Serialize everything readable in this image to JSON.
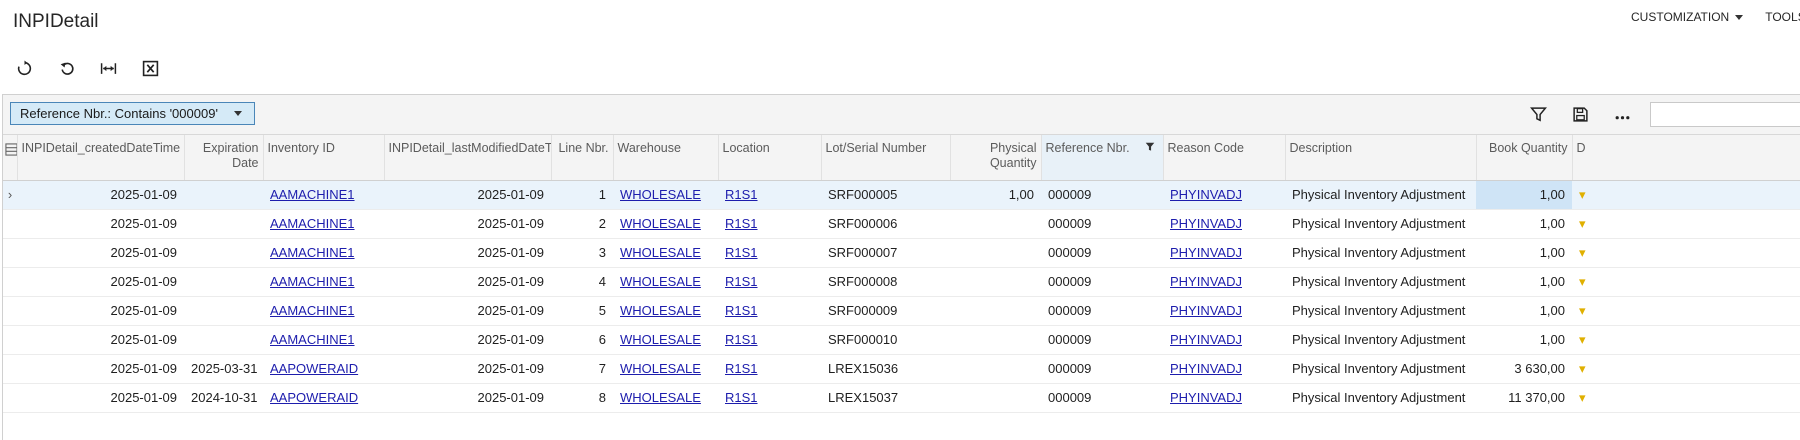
{
  "page": {
    "title": "INPIDetail",
    "menus": [
      "CUSTOMIZATION",
      "TOOLS"
    ]
  },
  "toolbar": {
    "buttons": [
      "refresh-icon",
      "undo-icon",
      "fit-to-screen-icon",
      "export-excel-icon"
    ]
  },
  "filter": {
    "chip_label": "Reference Nbr.: Contains '000009'",
    "search_placeholder": "",
    "icons": [
      "funnel-icon",
      "save-icon",
      "more-icon"
    ]
  },
  "colors": {
    "link": "#1d1dad",
    "chip_bg": "#d5eaf7",
    "chip_border": "#4a86b8",
    "active_row": "#eaf3fb"
  },
  "table": {
    "columns": [
      "INPIDetail_createdDateTime",
      "Expiration Date",
      "Inventory ID",
      "INPIDetail_lastModifiedDateTi",
      "Line Nbr.",
      "Warehouse",
      "Location",
      "Lot/Serial Number",
      "Physical Quantity",
      "Reference Nbr.",
      "Reason Code",
      "Description",
      "Book Quantity",
      "D"
    ],
    "rows": [
      [
        "2025-01-09",
        "",
        "AAMACHINE1",
        "2025-01-09",
        "1",
        "WHOLESALE",
        "R1S1",
        "SRF000005",
        "1,00",
        "000009",
        "PHYINVADJ",
        "Physical Inventory Adjustment",
        "1,00",
        "▾"
      ],
      [
        "2025-01-09",
        "",
        "AAMACHINE1",
        "2025-01-09",
        "2",
        "WHOLESALE",
        "R1S1",
        "SRF000006",
        "",
        "000009",
        "PHYINVADJ",
        "Physical Inventory Adjustment",
        "1,00",
        "▾"
      ],
      [
        "2025-01-09",
        "",
        "AAMACHINE1",
        "2025-01-09",
        "3",
        "WHOLESALE",
        "R1S1",
        "SRF000007",
        "",
        "000009",
        "PHYINVADJ",
        "Physical Inventory Adjustment",
        "1,00",
        "▾"
      ],
      [
        "2025-01-09",
        "",
        "AAMACHINE1",
        "2025-01-09",
        "4",
        "WHOLESALE",
        "R1S1",
        "SRF000008",
        "",
        "000009",
        "PHYINVADJ",
        "Physical Inventory Adjustment",
        "1,00",
        "▾"
      ],
      [
        "2025-01-09",
        "",
        "AAMACHINE1",
        "2025-01-09",
        "5",
        "WHOLESALE",
        "R1S1",
        "SRF000009",
        "",
        "000009",
        "PHYINVADJ",
        "Physical Inventory Adjustment",
        "1,00",
        "▾"
      ],
      [
        "2025-01-09",
        "",
        "AAMACHINE1",
        "2025-01-09",
        "6",
        "WHOLESALE",
        "R1S1",
        "SRF000010",
        "",
        "000009",
        "PHYINVADJ",
        "Physical Inventory Adjustment",
        "1,00",
        "▾"
      ],
      [
        "2025-01-09",
        "2025-03-31",
        "AAPOWERAID",
        "2025-01-09",
        "7",
        "WHOLESALE",
        "R1S1",
        "LREX15036",
        "",
        "000009",
        "PHYINVADJ",
        "Physical Inventory Adjustment",
        "3 630,00",
        "▾"
      ],
      [
        "2025-01-09",
        "2024-10-31",
        "AAPOWERAID",
        "2025-01-09",
        "8",
        "WHOLESALE",
        "R1S1",
        "LREX15037",
        "",
        "000009",
        "PHYINVADJ",
        "Physical Inventory Adjustment",
        "11 370,00",
        "▾"
      ]
    ],
    "active_row_marker": "›"
  }
}
